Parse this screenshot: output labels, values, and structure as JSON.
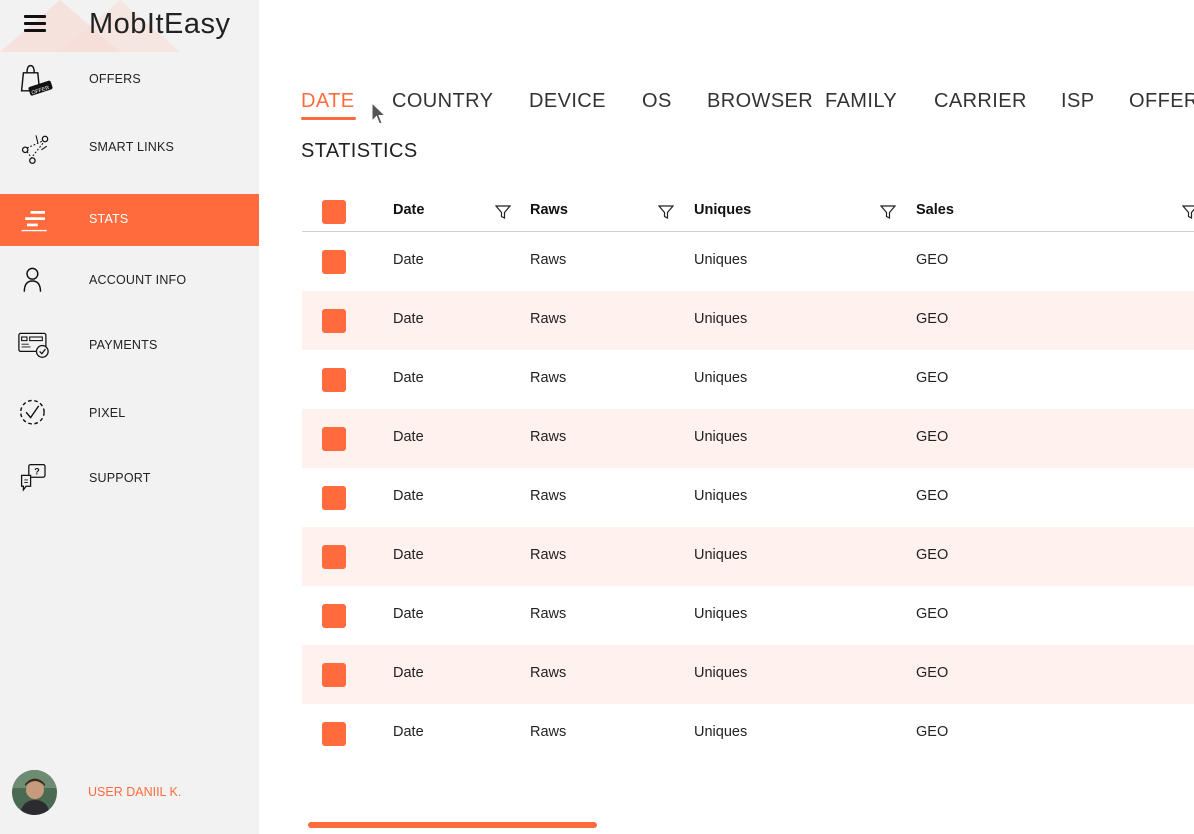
{
  "app": {
    "title": "MobItEasy"
  },
  "sidebar": {
    "items": [
      {
        "label": "OFFERS",
        "icon": "offer-bag-icon"
      },
      {
        "label": "SMART LINKS",
        "icon": "smart-links-icon"
      },
      {
        "label": "STATS",
        "icon": "stats-icon",
        "active": true
      },
      {
        "label": "ACCOUNT INFO",
        "icon": "user-icon"
      },
      {
        "label": "PAYMENTS",
        "icon": "payment-card-icon"
      },
      {
        "label": "PIXEL",
        "icon": "pixel-check-icon"
      },
      {
        "label": "SUPPORT",
        "icon": "support-chat-icon"
      }
    ],
    "user": {
      "name": "USER DANIIL K.",
      "icon": "avatar"
    },
    "offer_badge": "OFFER"
  },
  "tabs": [
    "DATE",
    "COUNTRY",
    "DEVICE",
    "OS",
    "BROWSER  FAMILY",
    "CARRIER",
    "ISP",
    "OFFER"
  ],
  "active_tab": "DATE",
  "section_title": "STATISTICS",
  "table": {
    "columns": [
      "Date",
      "Raws",
      "Uniques",
      "Sales"
    ],
    "rows": [
      [
        "Date",
        "Raws",
        "Uniques",
        "GEO"
      ],
      [
        "Date",
        "Raws",
        "Uniques",
        "GEO"
      ],
      [
        "Date",
        "Raws",
        "Uniques",
        "GEO"
      ],
      [
        "Date",
        "Raws",
        "Uniques",
        "GEO"
      ],
      [
        "Date",
        "Raws",
        "Uniques",
        "GEO"
      ],
      [
        "Date",
        "Raws",
        "Uniques",
        "GEO"
      ],
      [
        "Date",
        "Raws",
        "Uniques",
        "GEO"
      ],
      [
        "Date",
        "Raws",
        "Uniques",
        "GEO"
      ],
      [
        "Date",
        "Raws",
        "Uniques",
        "GEO"
      ]
    ]
  },
  "colors": {
    "accent": "#ff6b3d",
    "row_alt": "#fff1ee",
    "sidebar_bg": "#f2f2f2"
  }
}
